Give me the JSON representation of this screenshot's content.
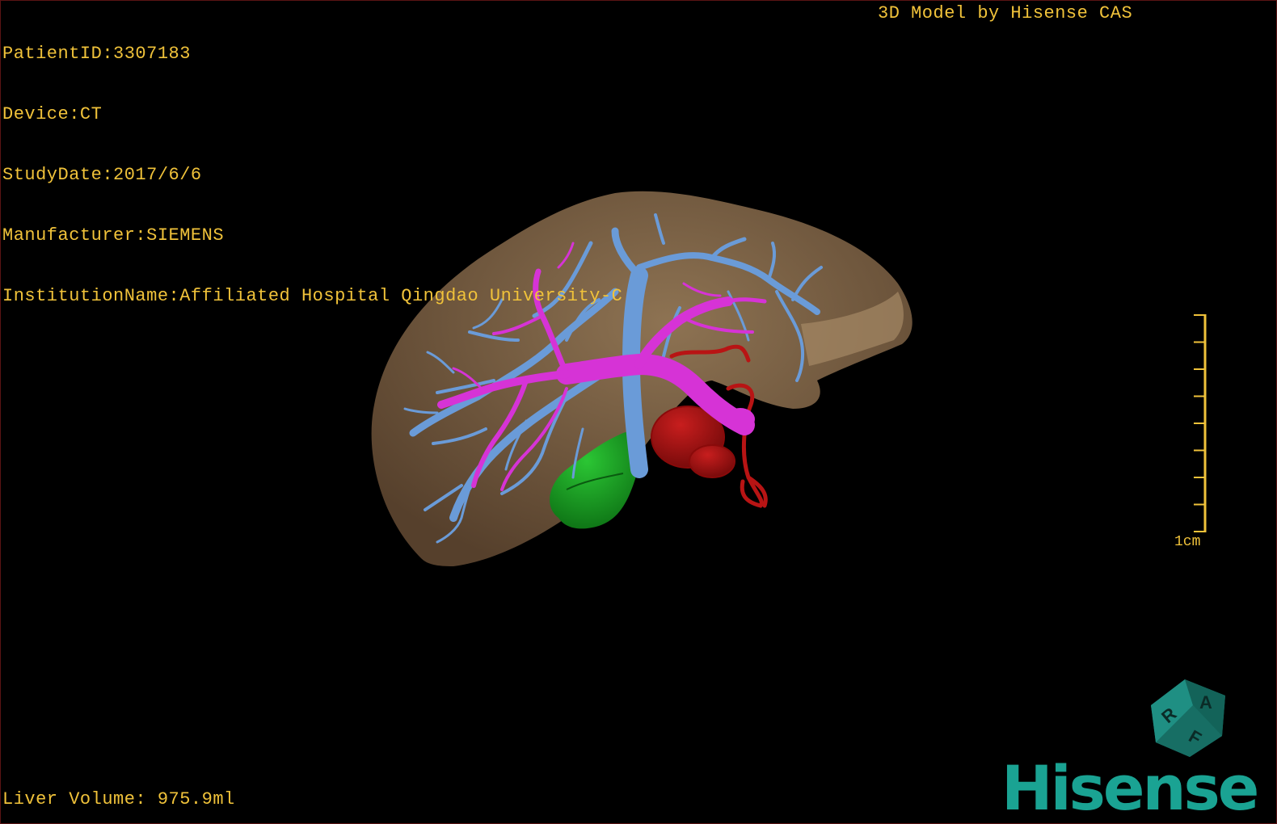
{
  "header": {
    "patient_id": "PatientID:3307183",
    "device": "Device:CT",
    "study_date": "StudyDate:2017/6/6",
    "manufacturer": "Manufacturer:SIEMENS",
    "institution": "InstitutionName:Affiliated Hospital Qingdao University-C"
  },
  "model_credit": "3D Model by Hisense CAS",
  "footer": {
    "liver_volume": "Liver Volume: 975.9ml"
  },
  "scale": {
    "label": "1cm",
    "ticks": 8
  },
  "orientation_cube": {
    "faces": [
      "A",
      "R",
      "F"
    ],
    "color": "#1a7a70"
  },
  "brand": {
    "logo_text": "Hisense",
    "color": "#1aa393"
  },
  "colors": {
    "overlay_text": "#f0c23a",
    "liver": "#8a6d4c",
    "hepatic_vein": "#6a9bd8",
    "portal_vein": "#d633d6",
    "artery": "#b11212",
    "gallbladder": "#14a020"
  }
}
